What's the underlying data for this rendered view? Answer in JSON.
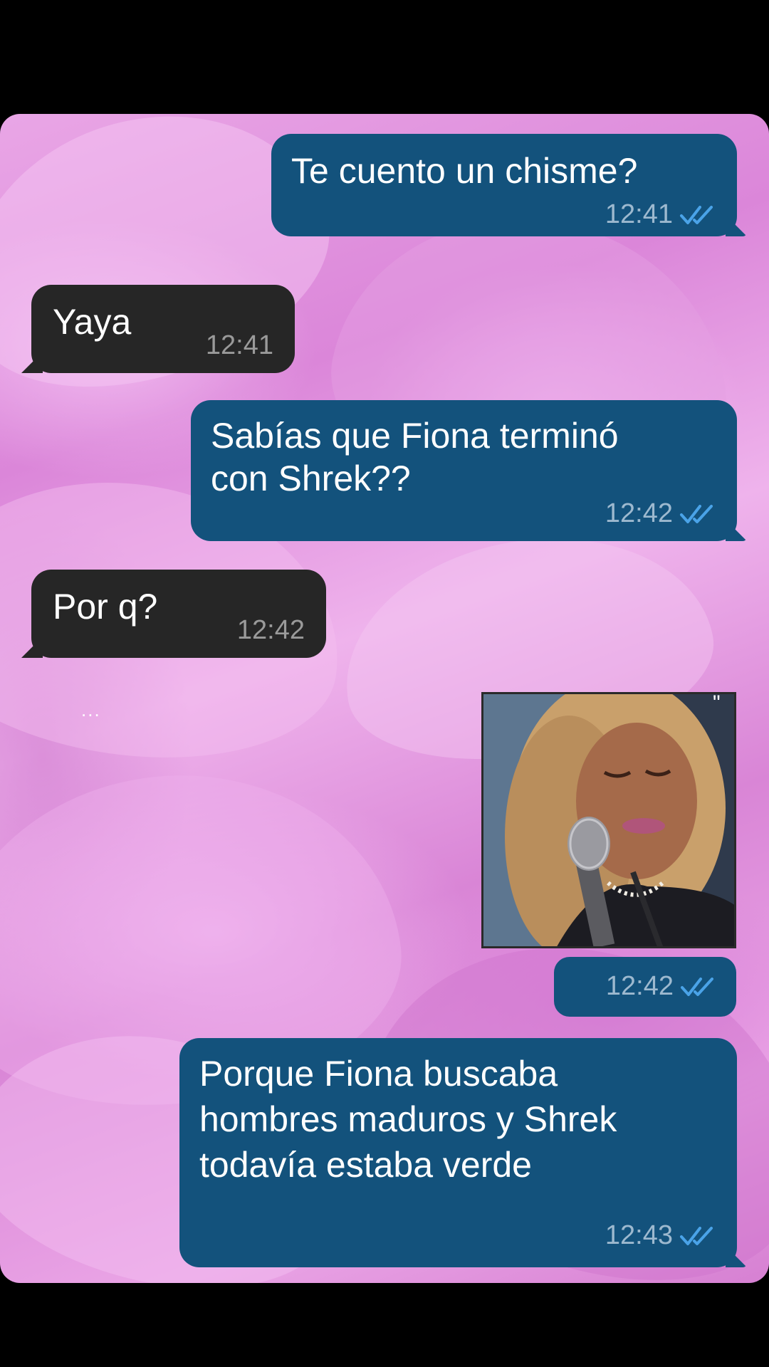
{
  "messages": [
    {
      "direction": "outgoing",
      "text": "Te cuento un chisme?",
      "time": "12:41",
      "status": "read"
    },
    {
      "direction": "incoming",
      "text": "Yaya",
      "time": "12:41"
    },
    {
      "direction": "outgoing",
      "text_lines": [
        "Sabías que Fiona terminó",
        "con Shrek??"
      ],
      "time": "12:42",
      "status": "read"
    },
    {
      "direction": "incoming",
      "text": "Por q?",
      "time": "12:42"
    },
    {
      "direction": "outgoing",
      "type": "image",
      "image_icon": "crying-singer-photo",
      "time": "12:42",
      "status": "read"
    },
    {
      "direction": "outgoing",
      "text_lines": [
        "Porque Fiona buscaba",
        "hombres maduros y Shrek",
        "todavía estaba verde"
      ],
      "time": "12:43",
      "status": "read"
    }
  ],
  "typing_indicator": "...",
  "colors": {
    "outgoing_bubble": "#13527c",
    "incoming_bubble": "#262626",
    "read_check": "#4aa3e8"
  }
}
